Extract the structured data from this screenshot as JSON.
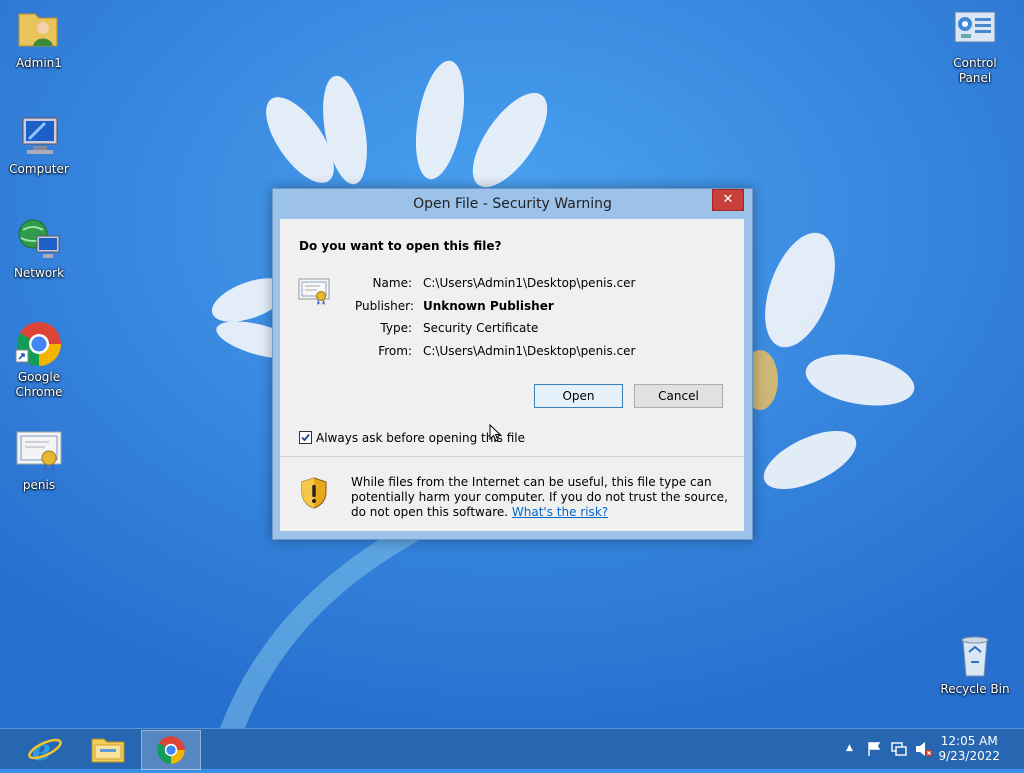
{
  "desktop": {
    "icons": [
      {
        "label": "Admin1"
      },
      {
        "label": "Computer"
      },
      {
        "label": "Network"
      },
      {
        "label": "Google Chrome"
      },
      {
        "label": "penis"
      },
      {
        "label": "Control Panel"
      },
      {
        "label": "Recycle Bin"
      }
    ]
  },
  "dialog": {
    "title": "Open File - Security Warning",
    "close_glyph": "✕",
    "question": "Do you want to open this file?",
    "properties": [
      {
        "label": "Name:",
        "value": "C:\\Users\\Admin1\\Desktop\\penis.cer"
      },
      {
        "label": "Publisher:",
        "value": "Unknown Publisher"
      },
      {
        "label": "Type:",
        "value": "Security Certificate"
      },
      {
        "label": "From:",
        "value": "C:\\Users\\Admin1\\Desktop\\penis.cer"
      }
    ],
    "open_label": "Open",
    "cancel_label": "Cancel",
    "checkbox_label": "Always ask before opening this file",
    "checkbox_checked": true,
    "warning_text": "While files from the Internet can be useful, this file type can potentially harm your computer. If you do not trust the source, do not open this software.",
    "warning_link": "What's the risk?"
  },
  "taskbar": {
    "clock_time": "12:05 AM",
    "clock_date": "9/23/2022",
    "tray_chevron": "▲"
  },
  "colors": {
    "accent": "#2a7bd8",
    "dialog_frame": "#9dc2ea",
    "close_red": "#c7403a",
    "link": "#0066cc"
  }
}
